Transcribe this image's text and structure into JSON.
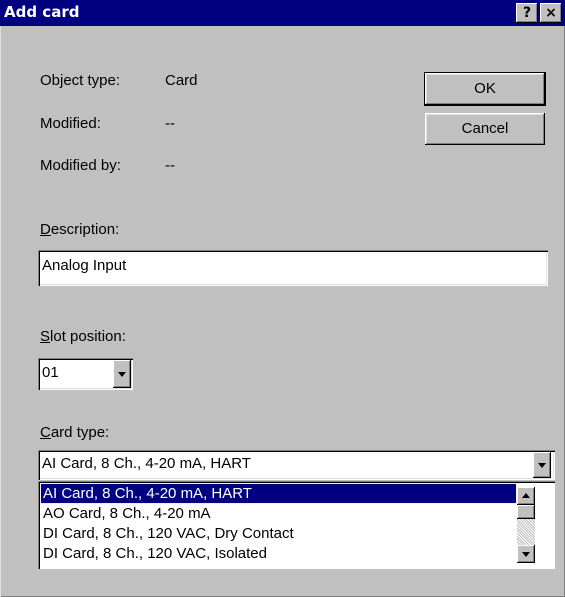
{
  "window": {
    "title": "Add card",
    "help_glyph": "?",
    "close_glyph": "×"
  },
  "info": {
    "object_type_label": "Object type:",
    "object_type_value": "Card",
    "modified_label": "Modified:",
    "modified_value": "--",
    "modified_by_label": "Modified by:",
    "modified_by_value": "--"
  },
  "buttons": {
    "ok": "OK",
    "cancel": "Cancel"
  },
  "description": {
    "label_accel": "D",
    "label_rest": "escription:",
    "value": "Analog Input"
  },
  "slot": {
    "label_accel": "S",
    "label_rest": "lot position:",
    "value": "01"
  },
  "card_type": {
    "label_accel": "C",
    "label_rest": "ard type:",
    "value": "AI Card, 8 Ch., 4-20 mA, HART",
    "options": [
      "AI Card, 8 Ch., 4-20 mA, HART",
      "AO Card, 8 Ch., 4-20 mA",
      "DI Card, 8 Ch., 120 VAC, Dry Contact",
      "DI Card, 8 Ch., 120 VAC, Isolated"
    ],
    "selected_index": 0
  },
  "icons": {
    "help": "help-icon",
    "close": "close-icon",
    "dropdown": "chevron-down-icon",
    "scroll_up": "scroll-up-icon",
    "scroll_down": "scroll-down-icon"
  },
  "colors": {
    "title_bar": "#000080",
    "face": "#c0c0c0",
    "selection": "#000080"
  }
}
